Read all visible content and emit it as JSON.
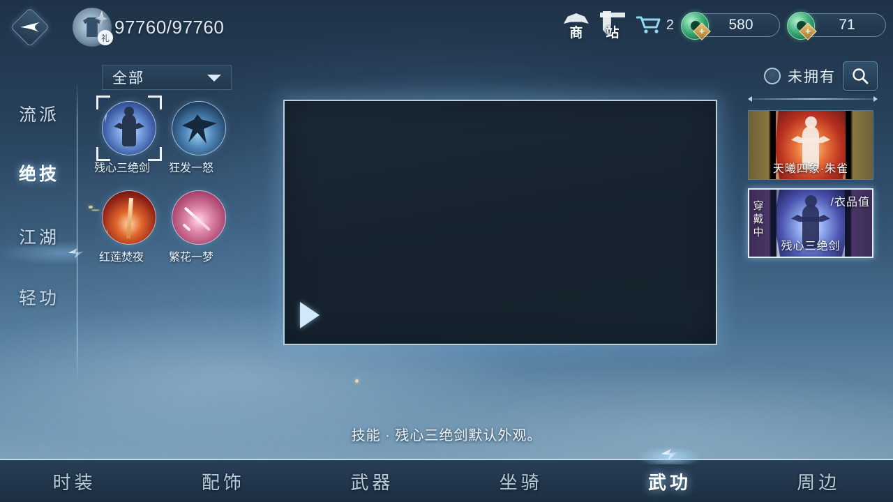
{
  "header": {
    "back_icon": "back-arrow-diamond-icon",
    "avatar_icon": "outfit-shirt-icon",
    "gift_badge": "礼",
    "fashion_score": "97760/97760",
    "shop_buttons": [
      {
        "icon": "merchant-hat-icon",
        "label": "商"
      },
      {
        "icon": "shop-banner-icon",
        "label": "站"
      }
    ],
    "cart": {
      "icon": "cart-icon",
      "count": "2"
    },
    "currencies": [
      {
        "icon": "jade-coin-icon",
        "value": "580",
        "plus": "+"
      },
      {
        "icon": "jade-gem-icon",
        "value": "71",
        "plus": "+"
      }
    ]
  },
  "sidebar": {
    "items": [
      {
        "label": "流派",
        "active": false
      },
      {
        "label": "绝技",
        "active": true
      },
      {
        "label": "江湖",
        "active": false
      },
      {
        "label": "轻功",
        "active": false
      }
    ]
  },
  "filter": {
    "selected": "全部",
    "caret_icon": "chevron-down-icon"
  },
  "skills": [
    {
      "name": "残心三绝剑",
      "selected": true
    },
    {
      "name": "狂发一怒",
      "selected": false
    },
    {
      "name": "红莲焚夜",
      "selected": false
    },
    {
      "name": "繁花一梦",
      "selected": false
    }
  ],
  "preview": {
    "play_icon": "play-triangle-icon",
    "caption": "技能 · 残心三绝剑默认外观。"
  },
  "right_panel": {
    "owned_filter": {
      "label": "未拥有",
      "checked": false,
      "icon": "radio-circle-icon"
    },
    "search_icon": "search-icon",
    "cards": [
      {
        "name": "天曦四象·朱雀",
        "selected": false,
        "equipped": "",
        "fashion_label": ""
      },
      {
        "name": "残心三绝剑",
        "selected": true,
        "equipped": "穿戴中",
        "fashion_label": "/衣品值"
      }
    ]
  },
  "bottom_nav": {
    "items": [
      {
        "label": "时装",
        "active": false
      },
      {
        "label": "配饰",
        "active": false
      },
      {
        "label": "武器",
        "active": false
      },
      {
        "label": "坐骑",
        "active": false
      },
      {
        "label": "武功",
        "active": true
      },
      {
        "label": "周边",
        "active": false
      }
    ],
    "marker_icon": "selected-tab-marker-icon"
  },
  "colors": {
    "accent": "#cfe9f8",
    "bg_top": "#1f3247",
    "bg_bottom": "#8aa8bd",
    "jade": "#3fae79"
  }
}
